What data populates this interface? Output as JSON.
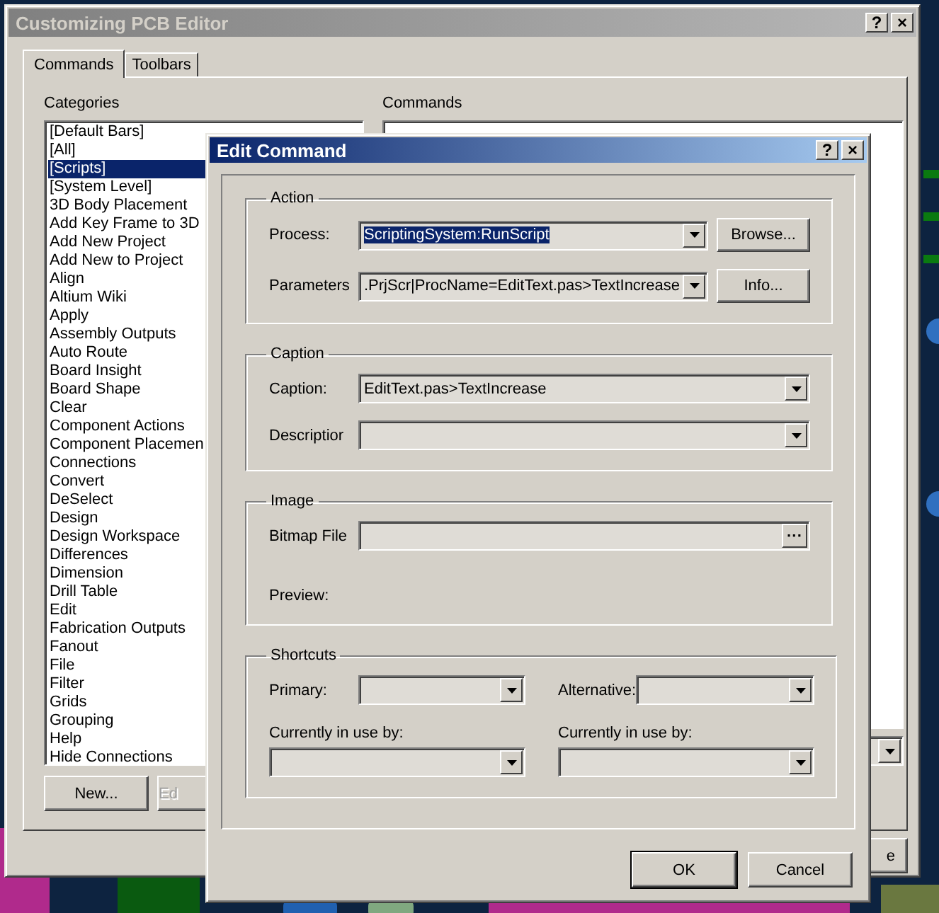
{
  "window": {
    "title": "Customizing PCB Editor",
    "help_button": "?",
    "close_button": "×"
  },
  "tabs": [
    {
      "label": "Commands",
      "selected": true
    },
    {
      "label": "Toolbars",
      "selected": false
    }
  ],
  "categories": {
    "label": "Categories",
    "items": [
      {
        "label": "[Default Bars]",
        "selected": false
      },
      {
        "label": "[All]",
        "selected": false
      },
      {
        "label": "[Scripts]",
        "selected": true
      },
      {
        "label": "[System Level]",
        "selected": false
      },
      {
        "label": "3D Body Placement",
        "selected": false
      },
      {
        "label": "Add Key Frame to 3D",
        "selected": false
      },
      {
        "label": "Add New Project",
        "selected": false
      },
      {
        "label": "Add New to Project",
        "selected": false
      },
      {
        "label": "Align",
        "selected": false
      },
      {
        "label": "Altium Wiki",
        "selected": false
      },
      {
        "label": "Apply",
        "selected": false
      },
      {
        "label": "Assembly Outputs",
        "selected": false
      },
      {
        "label": "Auto Route",
        "selected": false
      },
      {
        "label": "Board Insight",
        "selected": false
      },
      {
        "label": "Board Shape",
        "selected": false
      },
      {
        "label": "Clear",
        "selected": false
      },
      {
        "label": "Component Actions",
        "selected": false
      },
      {
        "label": "Component Placemen",
        "selected": false
      },
      {
        "label": "Connections",
        "selected": false
      },
      {
        "label": "Convert",
        "selected": false
      },
      {
        "label": "DeSelect",
        "selected": false
      },
      {
        "label": "Design",
        "selected": false
      },
      {
        "label": "Design Workspace",
        "selected": false
      },
      {
        "label": "Differences",
        "selected": false
      },
      {
        "label": "Dimension",
        "selected": false
      },
      {
        "label": "Drill Table",
        "selected": false
      },
      {
        "label": "Edit",
        "selected": false
      },
      {
        "label": "Fabrication Outputs",
        "selected": false
      },
      {
        "label": "Fanout",
        "selected": false
      },
      {
        "label": "File",
        "selected": false
      },
      {
        "label": "Filter",
        "selected": false
      },
      {
        "label": "Grids",
        "selected": false
      },
      {
        "label": "Grouping",
        "selected": false
      },
      {
        "label": "Help",
        "selected": false
      },
      {
        "label": "Hide Connections",
        "selected": false
      }
    ]
  },
  "commands": {
    "label": "Commands"
  },
  "list_buttons": [
    {
      "label": "New...",
      "disabled": false
    },
    {
      "label": "Ed",
      "disabled": true
    }
  ],
  "footer_button": {
    "label": "e"
  },
  "dialog": {
    "title": "Edit Command",
    "help_button": "?",
    "close_button": "×",
    "action": {
      "title": "Action",
      "process": {
        "label": "Process:",
        "value": "ScriptingSystem:RunScript",
        "selected": true
      },
      "browse_button": "Browse...",
      "parameters": {
        "label": "Parameters",
        "value": ".PrjScr|ProcName=EditText.pas>TextIncrease",
        "selected": false
      },
      "info_button": "Info..."
    },
    "caption": {
      "title": "Caption",
      "caption": {
        "label": "Caption:",
        "value": "EditText.pas>TextIncrease"
      },
      "description": {
        "label": "Descriptior"
      }
    },
    "image": {
      "title": "Image",
      "bitmap": {
        "label": "Bitmap File",
        "button": "···"
      },
      "preview": "Preview:"
    },
    "shortcuts": {
      "title": "Shortcuts",
      "primary": {
        "label": "Primary:"
      },
      "alternative": {
        "label": "Alternative:"
      },
      "in_use": [
        {
          "label": "Currently in use by:"
        },
        {
          "label": "Currently in use by:"
        }
      ]
    },
    "buttons": [
      {
        "label": "OK",
        "default": true
      },
      {
        "label": "Cancel",
        "default": false
      }
    ]
  }
}
